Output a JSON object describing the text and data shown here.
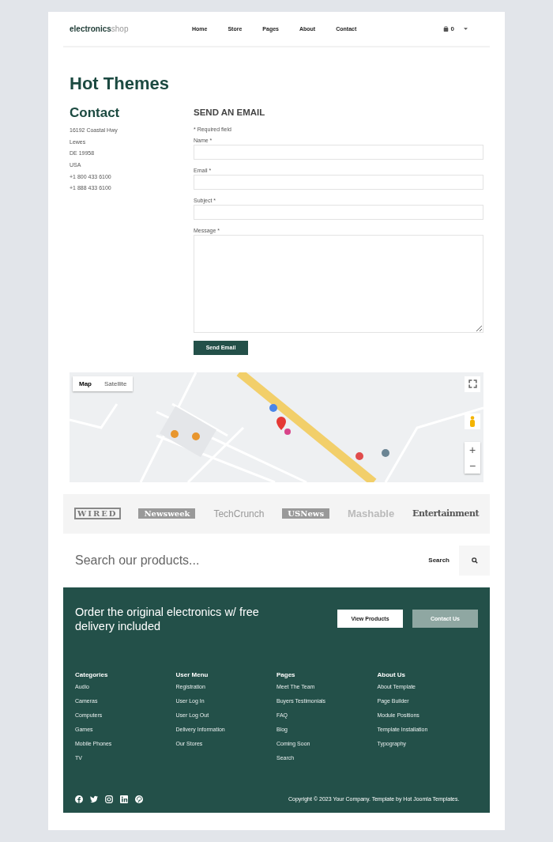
{
  "header": {
    "logo": {
      "brand": "electronics",
      "suffix": "shop"
    },
    "nav": [
      {
        "label": "Home",
        "selected": false
      },
      {
        "label": "Store",
        "selected": false
      },
      {
        "label": "Pages",
        "selected": false
      },
      {
        "label": "About",
        "selected": false
      },
      {
        "label": "Contact",
        "selected": false
      }
    ],
    "cart_count": "0"
  },
  "page_title": "Hot Themes",
  "contact": {
    "heading": "Contact",
    "lines": [
      "16192 Coastal Hwy",
      "Lewes",
      "DE 19958",
      "USA",
      "+1 800 433 6100",
      "+1 888 433 6100"
    ]
  },
  "email_form": {
    "heading": "SEND AN EMAIL",
    "required_note": "* Required field",
    "fields": [
      {
        "label": "Name *",
        "kind": "input"
      },
      {
        "label": "Email *",
        "kind": "input"
      },
      {
        "label": "Subject *",
        "kind": "input"
      },
      {
        "label": "Message *",
        "kind": "textarea"
      }
    ],
    "submit": "Send Email"
  },
  "map": {
    "kind": "picture",
    "map_types": [
      {
        "label": "Map",
        "selected": true
      },
      {
        "label": "Satellite",
        "selected": false
      }
    ],
    "zoom_in": "+",
    "zoom_out": "−"
  },
  "press_logos": [
    {
      "label": "WIRED",
      "kind": "boxed"
    },
    {
      "label": "Newsweek",
      "kind": "banner"
    },
    {
      "label": "TechCrunch",
      "kind": "light"
    },
    {
      "label": "USNews",
      "kind": "banner"
    },
    {
      "label": "Mashable",
      "kind": "bold"
    },
    {
      "label": "Entertainment",
      "kind": "condensed"
    }
  ],
  "search": {
    "placeholder": "Search our products...",
    "button": "Search"
  },
  "footer": {
    "cta": "Order the original electronics w/ free delivery included",
    "buttons": [
      {
        "label": "View Products",
        "kind": "primary"
      },
      {
        "label": "Contact Us",
        "kind": "secondary"
      }
    ],
    "columns": [
      {
        "title": "Categories",
        "links": [
          "Audio",
          "Cameras",
          "Computers",
          "Games",
          "Mobile Phones",
          "TV"
        ]
      },
      {
        "title": "User Menu",
        "links": [
          "Registration",
          "User Log In",
          "User Log Out",
          "Delivery Information",
          "Our Stores"
        ]
      },
      {
        "title": "Pages",
        "links": [
          "Meet The Team",
          "Buyers Testimonials",
          "FAQ",
          "Blog",
          "Coming Soon",
          "Search"
        ]
      },
      {
        "title": "About Us",
        "links": [
          "About Template",
          "Page Builder",
          "Module Positions",
          "Template Installation",
          "Typography"
        ]
      }
    ],
    "social": [
      {
        "kind": "facebook"
      },
      {
        "kind": "twitter"
      },
      {
        "kind": "instagram"
      },
      {
        "kind": "linkedin"
      },
      {
        "kind": "pinterest"
      }
    ],
    "copyright": "Copyright © 2023 Your Company. Template by Hot Joomla Templates."
  }
}
